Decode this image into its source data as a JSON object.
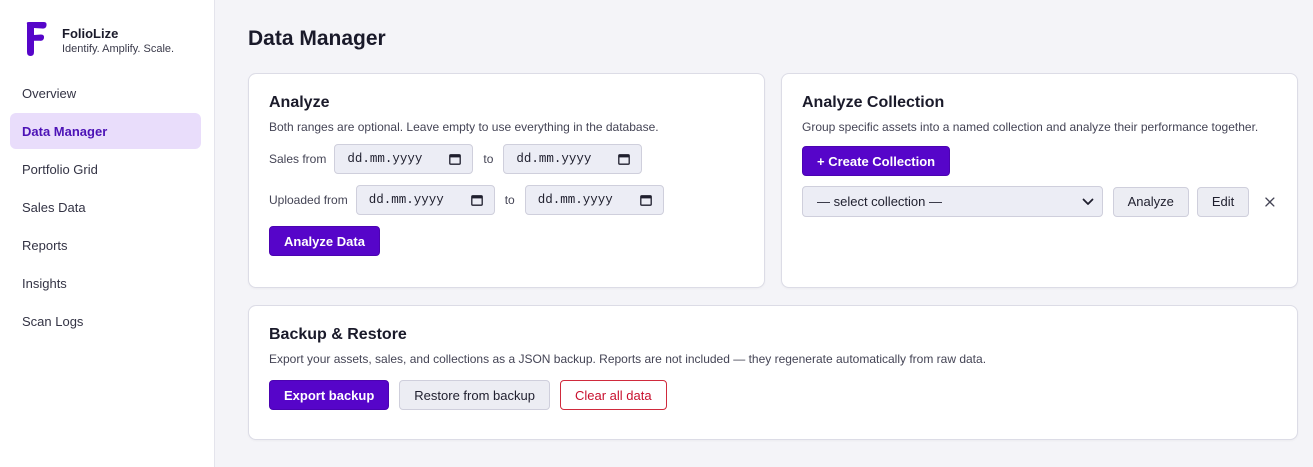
{
  "brand": {
    "name": "FolioLize",
    "tagline": "Identify. Amplify. Scale.",
    "color": "#5605c9"
  },
  "sidebar": {
    "items": [
      {
        "label": "Overview",
        "active": false
      },
      {
        "label": "Data Manager",
        "active": true
      },
      {
        "label": "Portfolio Grid",
        "active": false
      },
      {
        "label": "Sales Data",
        "active": false
      },
      {
        "label": "Reports",
        "active": false
      },
      {
        "label": "Insights",
        "active": false
      },
      {
        "label": "Scan Logs",
        "active": false
      }
    ]
  },
  "page": {
    "title": "Data Manager"
  },
  "analyze": {
    "title": "Analyze",
    "description": "Both ranges are optional. Leave empty to use everything in the database.",
    "sales_label": "Sales from",
    "uploaded_label": "Uploaded from",
    "to_label": "to",
    "date_placeholder": "dd.mm.yyyy",
    "button": "Analyze Data"
  },
  "collection": {
    "title": "Analyze Collection",
    "description": "Group specific assets into a named collection and analyze their performance together.",
    "create_button": "+ Create Collection",
    "select_value": "— select collection —",
    "analyze_button": "Analyze",
    "edit_button": "Edit"
  },
  "backup": {
    "title": "Backup & Restore",
    "description": "Export your assets, sales, and collections as a JSON backup. Reports are not included — they regenerate automatically from raw data.",
    "export_button": "Export backup",
    "restore_button": "Restore from backup",
    "clear_button": "Clear all data"
  },
  "colors": {
    "accent": "#5605c9",
    "active_nav_bg": "#e9ddfb",
    "danger": "#c8102e"
  }
}
